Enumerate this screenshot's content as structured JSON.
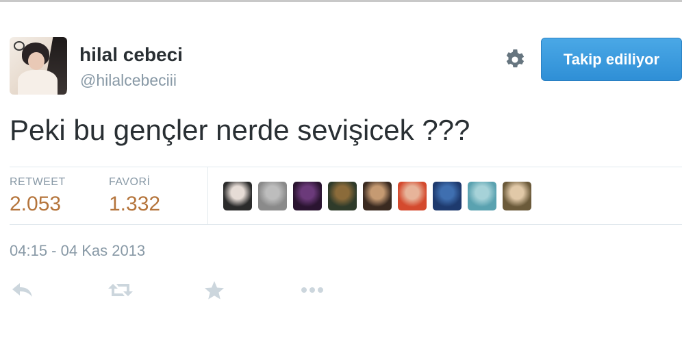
{
  "user": {
    "name": "hilal cebeci",
    "handle": "@hilalcebeciii"
  },
  "follow_button": {
    "label": "Takip ediliyor"
  },
  "tweet": {
    "text": "Peki bu gençler nerde sevişicek ???"
  },
  "stats": {
    "retweet_label": "RETWEET",
    "retweet_count": "2.053",
    "favorite_label": "FAVORİ",
    "favorite_count": "1.332"
  },
  "favorited_by": [
    {
      "c1": "#2b2b2b",
      "c2": "#e6dcd6"
    },
    {
      "c1": "#8a8a8a",
      "c2": "#bdbdbd"
    },
    {
      "c1": "#2a1430",
      "c2": "#6b3a7a"
    },
    {
      "c1": "#2f3b2a",
      "c2": "#8b6b3a"
    },
    {
      "c1": "#3a2a20",
      "c2": "#c59a72"
    },
    {
      "c1": "#d44a2e",
      "c2": "#e7b49a"
    },
    {
      "c1": "#1e3a6e",
      "c2": "#3f6fb0"
    },
    {
      "c1": "#5aa2b0",
      "c2": "#a6d2d8"
    },
    {
      "c1": "#6b5a3a",
      "c2": "#e1c9a8"
    }
  ],
  "timestamp": "04:15 - 04 Kas 2013",
  "icons": {
    "gear": "gear-icon",
    "reply": "reply-icon",
    "retweet": "retweet-icon",
    "favorite": "star-icon",
    "more": "more-icon"
  },
  "colors": {
    "follow_button": "#3498db",
    "stat_value": "#b5753c",
    "muted_text": "#8899a6",
    "action_icons": "#ccd6dd"
  }
}
